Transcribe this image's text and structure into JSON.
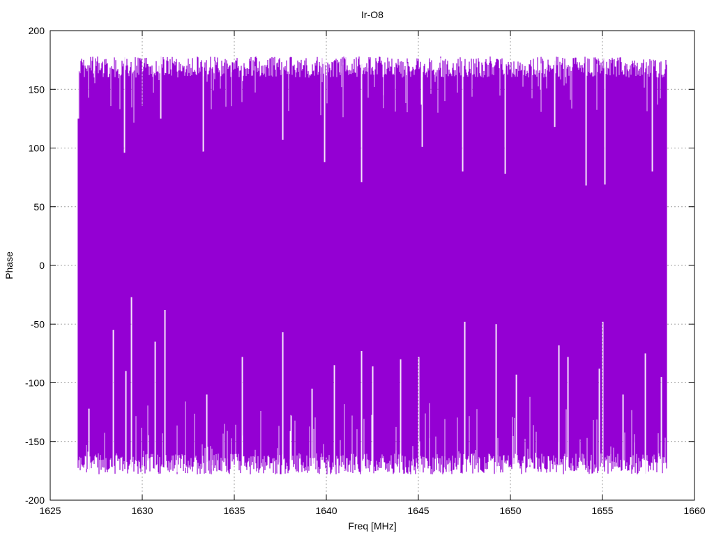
{
  "chart_data": {
    "type": "line",
    "title": "Ir-O8",
    "xlabel": "Freq [MHz]",
    "ylabel": "Phase",
    "xlim": [
      1625,
      1660
    ],
    "ylim": [
      -200,
      200
    ],
    "x_ticks": [
      1625,
      1630,
      1635,
      1640,
      1645,
      1650,
      1655,
      1660
    ],
    "y_ticks": [
      200,
      150,
      100,
      50,
      0,
      -50,
      -100,
      -150,
      -200
    ],
    "grid": true,
    "legend": "none",
    "series": [
      {
        "color": "#9400d3",
        "x_range": [
          1626.5,
          1658.5
        ],
        "typical_max": 178,
        "typical_min": -178,
        "representative_peaks": [
          {
            "x": 1626.5,
            "y": 125
          },
          {
            "x": 1629.0,
            "y": 96
          },
          {
            "x": 1631.0,
            "y": 125
          },
          {
            "x": 1633.3,
            "y": 97
          },
          {
            "x": 1637.6,
            "y": 107
          },
          {
            "x": 1639.9,
            "y": 88
          },
          {
            "x": 1641.9,
            "y": 71
          },
          {
            "x": 1645.2,
            "y": 101
          },
          {
            "x": 1647.4,
            "y": 80
          },
          {
            "x": 1649.7,
            "y": 78
          },
          {
            "x": 1652.4,
            "y": 118
          },
          {
            "x": 1654.1,
            "y": 68
          },
          {
            "x": 1655.1,
            "y": 69
          },
          {
            "x": 1657.7,
            "y": 80
          }
        ],
        "representative_troughs": [
          {
            "x": 1627.1,
            "y": -122
          },
          {
            "x": 1628.4,
            "y": -55
          },
          {
            "x": 1629.1,
            "y": -90
          },
          {
            "x": 1629.4,
            "y": -27
          },
          {
            "x": 1630.7,
            "y": -65
          },
          {
            "x": 1631.2,
            "y": -38
          },
          {
            "x": 1633.5,
            "y": -110
          },
          {
            "x": 1635.4,
            "y": -78
          },
          {
            "x": 1637.6,
            "y": -57
          },
          {
            "x": 1639.2,
            "y": -105
          },
          {
            "x": 1640.4,
            "y": -85
          },
          {
            "x": 1641.9,
            "y": -73
          },
          {
            "x": 1642.5,
            "y": -86
          },
          {
            "x": 1644.0,
            "y": -80
          },
          {
            "x": 1645.0,
            "y": -78
          },
          {
            "x": 1647.5,
            "y": -48
          },
          {
            "x": 1649.2,
            "y": -50
          },
          {
            "x": 1650.3,
            "y": -93
          },
          {
            "x": 1652.6,
            "y": -68
          },
          {
            "x": 1653.1,
            "y": -78
          },
          {
            "x": 1654.8,
            "y": -88
          },
          {
            "x": 1655.0,
            "y": -48
          },
          {
            "x": 1656.1,
            "y": -110
          },
          {
            "x": 1657.3,
            "y": -75
          },
          {
            "x": 1658.2,
            "y": -95
          }
        ]
      }
    ]
  }
}
